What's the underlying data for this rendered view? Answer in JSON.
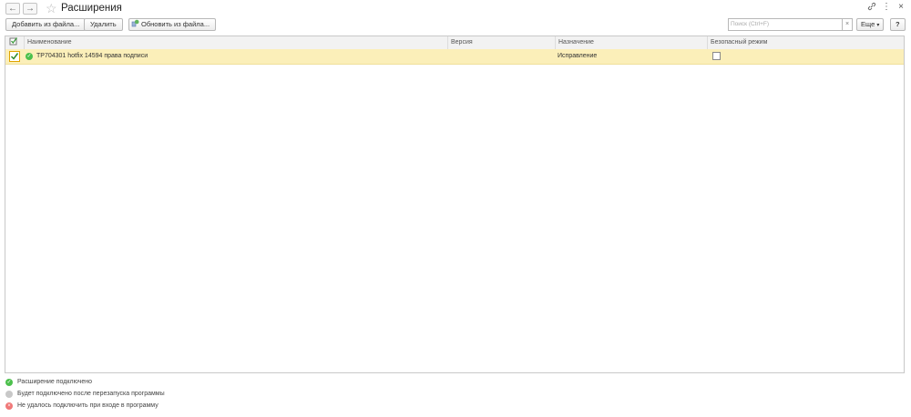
{
  "window": {
    "title": "Расширения"
  },
  "nav": {
    "back_icon": "arrow-left-icon",
    "forward_icon": "arrow-right-icon",
    "favorite_icon": "star-icon"
  },
  "title_icons": {
    "link_icon": "link-icon",
    "more_icon": "vertical-dots-icon",
    "close_icon": "close-icon"
  },
  "toolbar": {
    "add_from_file": "Добавить из файла...",
    "delete": "Удалить",
    "update_from_file": "Обновить из файла...",
    "search_placeholder": "Поиск (Ctrl+F)",
    "search_clear": "×",
    "more": "Еще",
    "help": "?"
  },
  "table": {
    "columns": [
      "Наименование",
      "Версия",
      "Назначение",
      "Безопасный режим"
    ],
    "rows": [
      {
        "active": true,
        "status": "connected",
        "name": "ТР704301 hotfix 14594 права подписи",
        "version": "",
        "purpose": "Исправление",
        "safe_mode": false
      }
    ]
  },
  "legend": [
    {
      "text": "Расширение подключено",
      "color": "#4cc04c"
    },
    {
      "text": "Будет подключено после перезапуска программы",
      "color": "#c8c8c8"
    },
    {
      "text": "Не удалось подключить при входе в программу",
      "color": "#f07878"
    }
  ]
}
